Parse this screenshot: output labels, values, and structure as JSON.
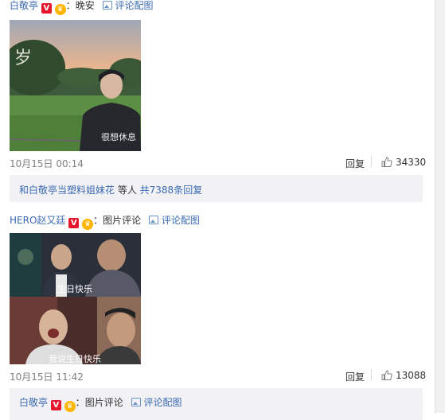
{
  "comment1": {
    "author": "白敬亭",
    "separator": "：",
    "text": "晚安",
    "pic_link": "评论配图",
    "time": "10月15日 00:14",
    "reply_label": "回复",
    "likes": "34330",
    "summary": {
      "name": "和白敬亭当塑料姐妹花",
      "middle": " 等人 ",
      "count": "共7388条回复"
    },
    "image_text": "很想休息"
  },
  "comment2": {
    "author": "HERO赵又廷",
    "separator": "：",
    "text": "图片评论",
    "pic_link": "评论配图",
    "time": "10月15日 11:42",
    "reply_label": "回复",
    "likes": "13088",
    "image_caption_top": "生日快乐",
    "image_caption_bottom": "我说生日快乐"
  },
  "reply1": {
    "author": "白敬亭",
    "separator": "：",
    "text": "图片评论",
    "pic_link": "评论配图"
  },
  "colors": {
    "name": "#3b6ab1",
    "vbadge": "#e6162d",
    "reply_bg": "#f2f2f5"
  }
}
